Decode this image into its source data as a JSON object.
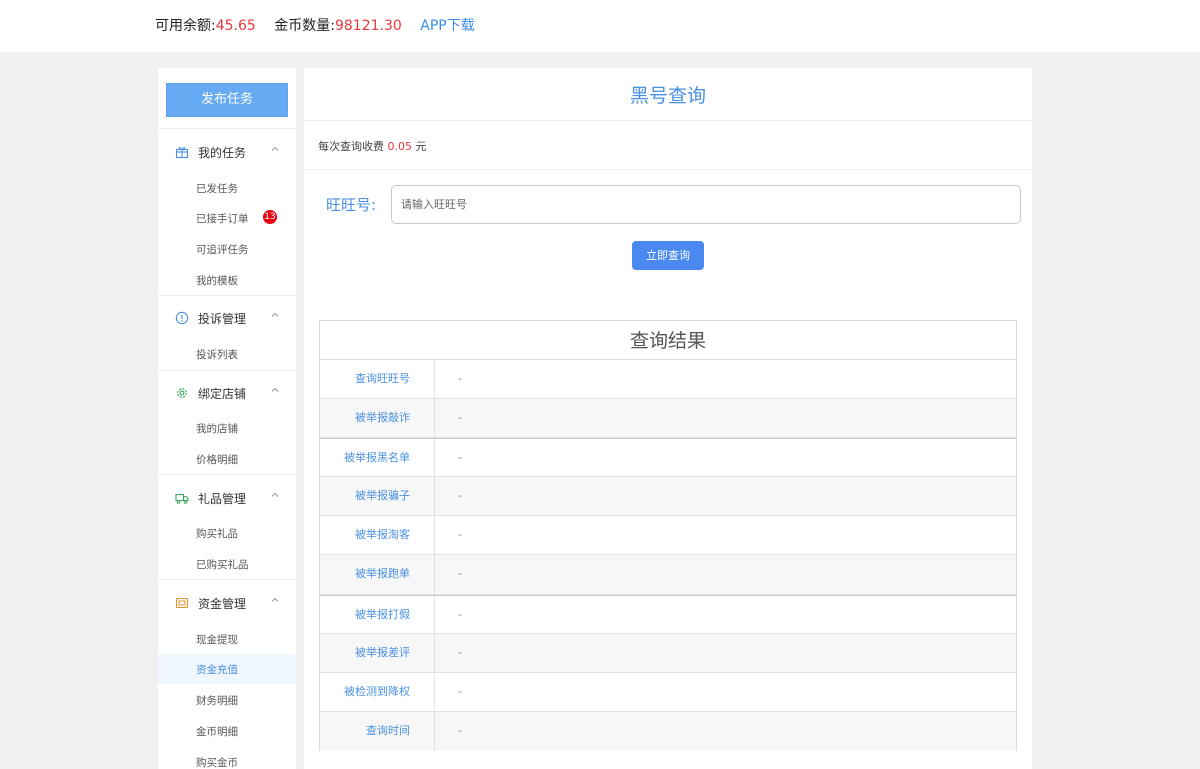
{
  "topbar": {
    "balance_label": "可用余额:",
    "balance_value": "45.65",
    "coins_label": "金币数量:",
    "coins_value": "98121.30",
    "app_link": "APP下载"
  },
  "sidebar": {
    "publish_button": "发布任务",
    "groups": [
      {
        "title": "我的任务",
        "icon": "gift-icon",
        "items": [
          "已发任务",
          "已接手订单",
          "可追评任务",
          "我的模板"
        ],
        "badge": "13"
      },
      {
        "title": "投诉管理",
        "icon": "info-circle-icon",
        "items": [
          "投诉列表"
        ]
      },
      {
        "title": "绑定店铺",
        "icon": "gear-icon",
        "items": [
          "我的店铺",
          "价格明细"
        ]
      },
      {
        "title": "礼品管理",
        "icon": "truck-icon",
        "items": [
          "购买礼品",
          "已购买礼品"
        ]
      },
      {
        "title": "资金管理",
        "icon": "wallet-icon",
        "items": [
          "现金提现",
          "资金充值",
          "财务明细",
          "金币明细",
          "购买金币"
        ]
      }
    ],
    "active_item": "资金充值"
  },
  "main": {
    "title": "黑号查询",
    "fee_prefix": "每次查询收费",
    "fee_value": "0.05",
    "fee_unit": "元",
    "wangwang_label": "旺旺号:",
    "wangwang_placeholder": "请输入旺旺号",
    "wangwang_value": "",
    "query_button": "立即查询",
    "result_title": "查询结果",
    "results": [
      {
        "key": "查询旺旺号",
        "value": "-"
      },
      {
        "key": "被举报敲诈",
        "value": "-"
      },
      {
        "key": "被举报黑名单",
        "value": "-"
      },
      {
        "key": "被举报骗子",
        "value": "-"
      },
      {
        "key": "被举报淘客",
        "value": "-"
      },
      {
        "key": "被举报跑单",
        "value": "-"
      },
      {
        "key": "被举报打假",
        "value": "-"
      },
      {
        "key": "被举报差评",
        "value": "-"
      },
      {
        "key": "被检测到降权",
        "value": "-"
      },
      {
        "key": "查询时间",
        "value": "-"
      }
    ]
  },
  "colors": {
    "accent_blue": "#4a90e2",
    "publish_button_bg": "#66aaf3",
    "value_red": "#e6373b",
    "badge_red": "#e60012"
  }
}
